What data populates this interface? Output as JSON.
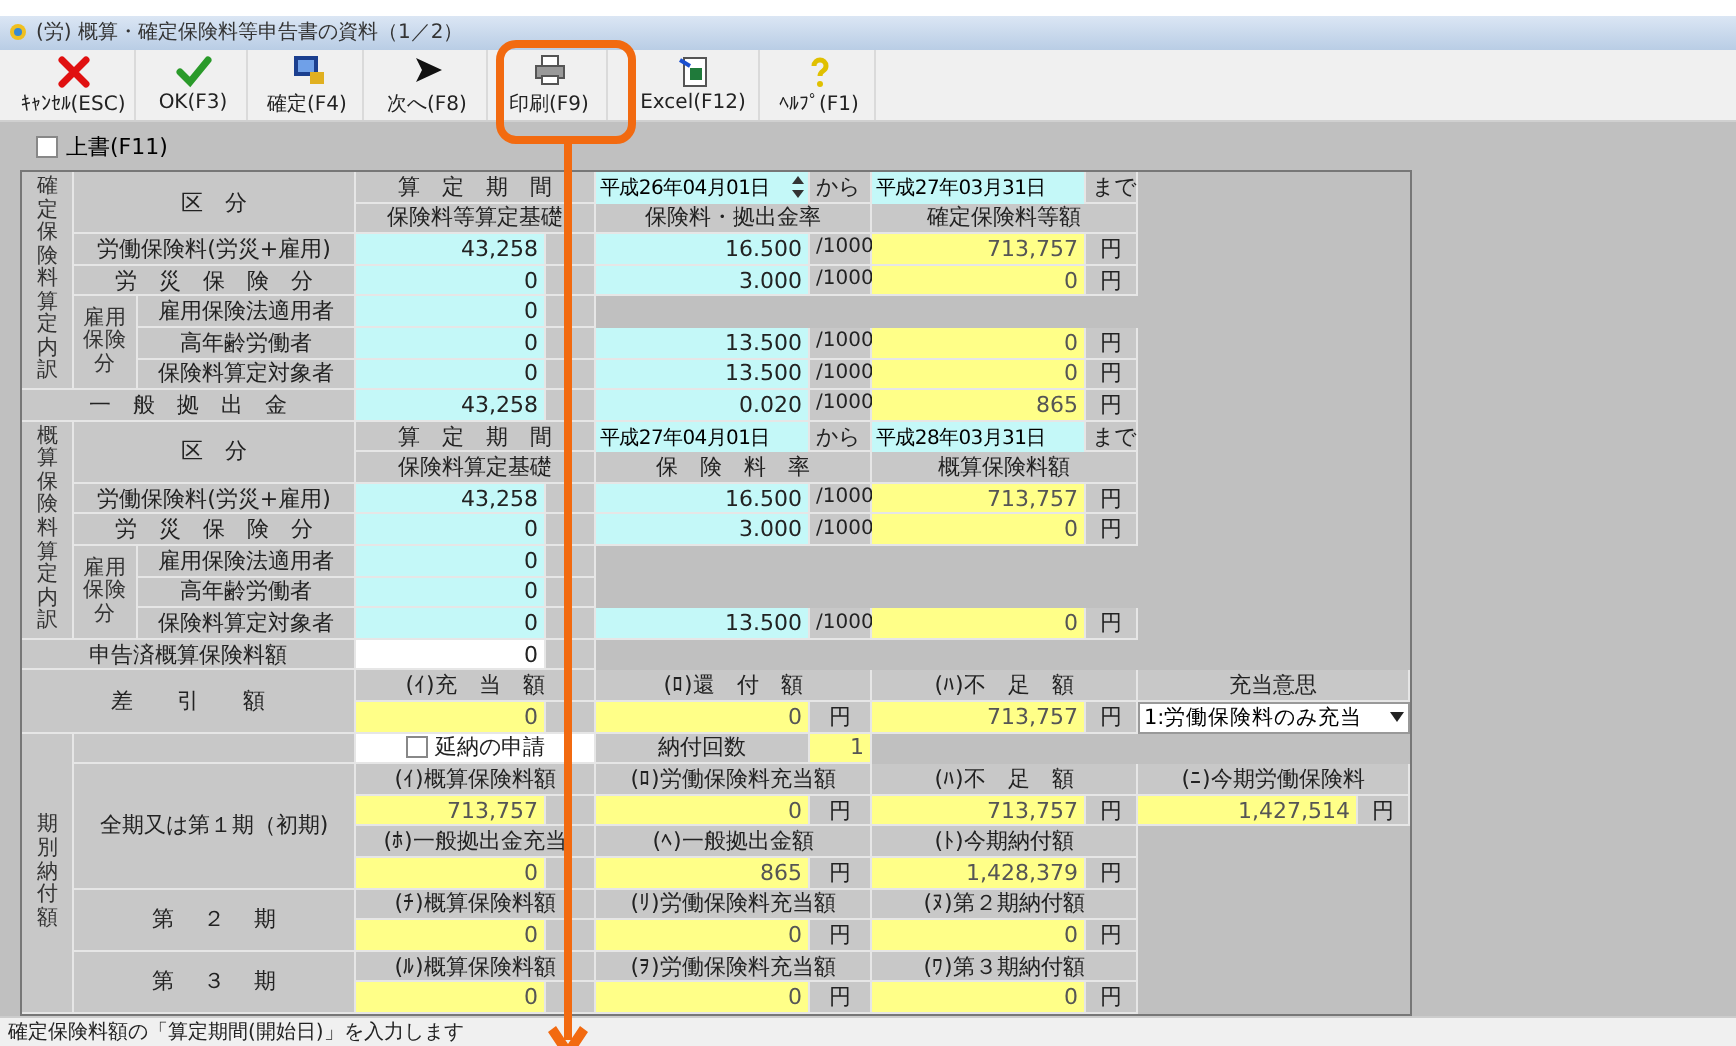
{
  "window": {
    "title": "(労) 概算・確定保険料等申告書の資料（1／2）"
  },
  "toolbar": [
    {
      "kind": "cancel",
      "label": "ｷｬﾝｾﾙ(ESC)"
    },
    {
      "kind": "ok",
      "label": "OK(F3)"
    },
    {
      "kind": "confirm",
      "label": "確定(F4)"
    },
    {
      "kind": "next",
      "label": "次へ(F8)"
    },
    {
      "kind": "print",
      "label": "印刷(F9)"
    },
    {
      "kind": "excel",
      "label": "Excel(F12)"
    },
    {
      "kind": "help",
      "label": "ﾍﾙﾌﾟ(F1)"
    }
  ],
  "overwrite": {
    "label": "上書(F11)",
    "checked": false
  },
  "confirmed": {
    "section_label": "確定保険料算定内訳",
    "category_header": "区　分",
    "period": {
      "header": "算　定　期　間",
      "start": "平成26年04月01日",
      "spinner": true,
      "from": "から",
      "end": "平成27年03月31日",
      "until": "まで"
    },
    "column_headers": [
      "保険料等算定基礎",
      "保険料・拠出金率",
      "確定保険料等額"
    ],
    "group_label": "雇用保険分",
    "rows": [
      {
        "label": "労働保険料(労災+雇用)",
        "grouped": false,
        "base": "43,258",
        "rate": "16.500",
        "rate_unit": "/1000",
        "amount": "713,757",
        "amount_unit": "円"
      },
      {
        "label": "労　災　保　険　分",
        "grouped": false,
        "base": "0",
        "rate": "3.000",
        "rate_unit": "/1000",
        "amount": "0",
        "amount_unit": "円"
      },
      {
        "label": "雇用保険法適用者",
        "grouped": true,
        "base": "0"
      },
      {
        "label": "高年齢労働者",
        "grouped": true,
        "base": "0",
        "rate": "13.500",
        "rate_unit": "/1000",
        "amount": "0",
        "amount_unit": "円"
      },
      {
        "label": "保険料算定対象者",
        "grouped": true,
        "base": "0",
        "rate": "13.500",
        "rate_unit": "/1000",
        "amount": "0",
        "amount_unit": "円"
      }
    ],
    "general": {
      "label": "一　般　拠　出　金",
      "base": "43,258",
      "rate": "0.020",
      "rate_unit": "/1000",
      "amount": "865",
      "amount_unit": "円"
    }
  },
  "estimate": {
    "section_label": "概算保険料算定内訳",
    "category_header": "区　分",
    "period": {
      "header": "算　定　期　間",
      "start": "平成27年04月01日",
      "spinner": false,
      "from": "から",
      "end": "平成28年03月31日",
      "until": "まで"
    },
    "column_headers": [
      "保険料算定基礎",
      "保　険　料　率",
      "概算保険料額"
    ],
    "group_label": "雇用保険分",
    "rows": [
      {
        "label": "労働保険料(労災+雇用)",
        "grouped": false,
        "base": "43,258",
        "rate": "16.500",
        "rate_unit": "/1000",
        "amount": "713,757",
        "amount_unit": "円"
      },
      {
        "label": "労　災　保　険　分",
        "grouped": false,
        "base": "0",
        "rate": "3.000",
        "rate_unit": "/1000",
        "amount": "0",
        "amount_unit": "円"
      },
      {
        "label": "雇用保険法適用者",
        "grouped": true,
        "base": "0"
      },
      {
        "label": "高年齢労働者",
        "grouped": true,
        "base": "0"
      },
      {
        "label": "保険料算定対象者",
        "grouped": true,
        "base": "0",
        "rate": "13.500",
        "rate_unit": "/1000",
        "amount": "0",
        "amount_unit": "円"
      }
    ]
  },
  "reported": {
    "label": "申告済概算保険料額",
    "value": "0"
  },
  "difference": {
    "label": "差　　引　　額",
    "items": [
      {
        "header": "(ｲ)充　当　額",
        "value": "0"
      },
      {
        "header": "(ﾛ)還　付　額",
        "value": "0",
        "unit": "円"
      },
      {
        "header": "(ﾊ)不　足　額",
        "value": "713,757",
        "unit": "円"
      }
    ],
    "allocation": {
      "header": "充当意思",
      "value": "1:労働保険料のみ充当"
    }
  },
  "installments": {
    "section_label": "期別納付額",
    "deferral": {
      "label": "延納の申請",
      "checked": false
    },
    "count_label": "納付回数",
    "count": "1",
    "periods": [
      {
        "label": "全期又は第１期（初期)",
        "lines": [
          [
            {
              "header": "(ｲ)概算保険料額",
              "value": "713,757"
            },
            {
              "header": "(ﾛ)労働保険料充当額",
              "value": "0",
              "unit": "円"
            },
            {
              "header": "(ﾊ)不　足　額",
              "value": "713,757",
              "unit": "円"
            },
            {
              "header": "(ﾆ)今期労働保険料",
              "value": "1,427,514",
              "unit": "円"
            }
          ],
          [
            {
              "header": "(ﾎ)一般拠出金充当",
              "value": "0"
            },
            {
              "header": "(ﾍ)一般拠出金額",
              "value": "865",
              "unit": "円"
            },
            {
              "header": "(ﾄ)今期納付額",
              "value": "1,428,379",
              "unit": "円"
            }
          ]
        ]
      },
      {
        "label": "第　 ２　 期",
        "lines": [
          [
            {
              "header": "(ﾁ)概算保険料額",
              "value": "0"
            },
            {
              "header": "(ﾘ)労働保険料充当額",
              "value": "0",
              "unit": "円"
            },
            {
              "header": "(ﾇ)第２期納付額",
              "value": "0",
              "unit": "円"
            }
          ]
        ]
      },
      {
        "label": "第　 ３　 期",
        "lines": [
          [
            {
              "header": "(ﾙ)概算保険料額",
              "value": "0"
            },
            {
              "header": "(ｦ)労働保険料充当額",
              "value": "0",
              "unit": "円"
            },
            {
              "header": "(ﾜ)第３期納付額",
              "value": "0",
              "unit": "円"
            }
          ]
        ]
      }
    ]
  },
  "status_bar": "確定保険料額の「算定期間(開始日)」を入力します"
}
